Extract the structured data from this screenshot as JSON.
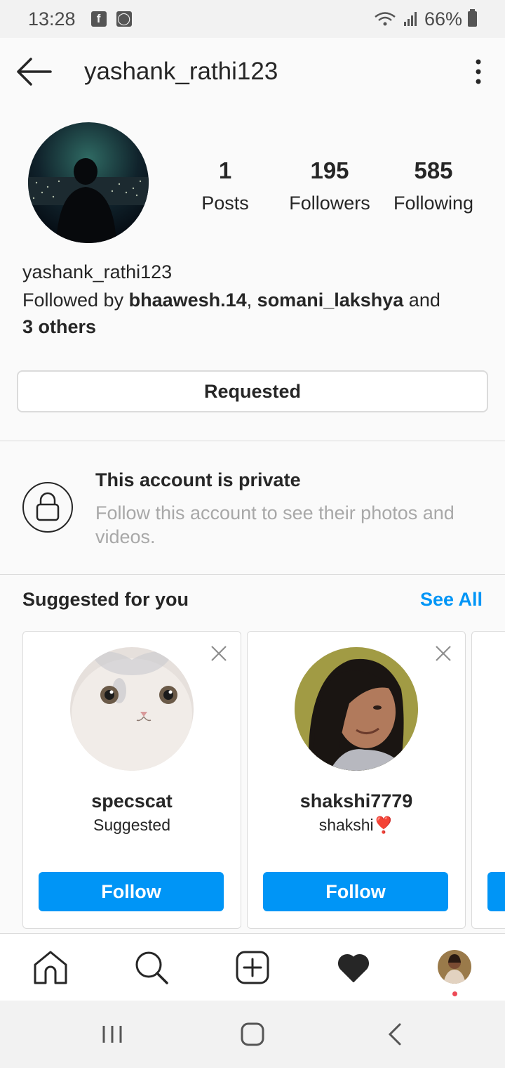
{
  "status_bar": {
    "time": "13:28",
    "battery": "66%"
  },
  "header": {
    "title": "yashank_rathi123"
  },
  "profile": {
    "stats": [
      {
        "value": "1",
        "label": "Posts"
      },
      {
        "value": "195",
        "label": "Followers"
      },
      {
        "value": "585",
        "label": "Following"
      }
    ],
    "username": "yashank_rathi123",
    "followed_by_prefix": "Followed by ",
    "followed_by_user1": "bhaawesh.14",
    "followed_by_sep": ", ",
    "followed_by_user2": "somani_lakshya",
    "followed_by_and": " and",
    "followed_by_others": "3 others",
    "requested_label": "Requested"
  },
  "private": {
    "title": "This account is private",
    "text": "Follow this account to see their photos and videos."
  },
  "suggestions": {
    "title": "Suggested for you",
    "see_all": "See All",
    "cards": [
      {
        "username": "specscat",
        "subtitle": "Suggested",
        "follow_label": "Follow"
      },
      {
        "username": "shakshi7779",
        "subtitle": "shakshi❣️",
        "follow_label": "Follow"
      }
    ]
  },
  "colors": {
    "accent": "#0095f6",
    "text": "#262626",
    "muted": "#a8a8a8",
    "border": "#dbdbdb"
  },
  "icons": {
    "back": "back-arrow-icon",
    "more": "more-vertical-icon",
    "lock": "lock-icon",
    "close": "close-icon",
    "home": "home-icon",
    "search": "search-icon",
    "add": "add-post-icon",
    "activity": "heart-icon"
  }
}
